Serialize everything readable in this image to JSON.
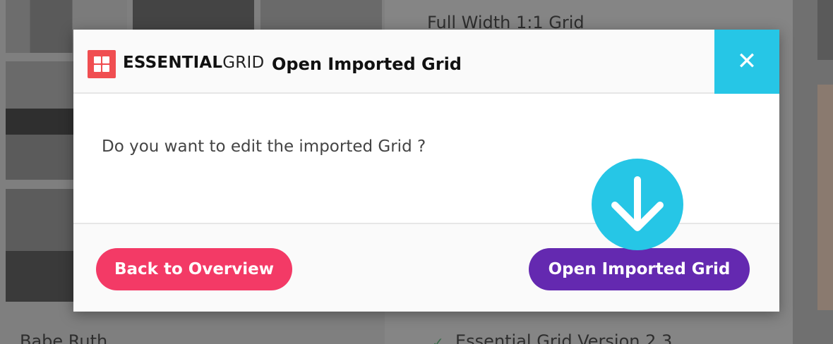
{
  "background": {
    "section_title": "Full Width 1:1 Grid",
    "item_name": "Babe Ruth",
    "version_label": "Essential Grid Version 2.3",
    "check_glyph": "✓"
  },
  "modal": {
    "brand": {
      "bold": "ESSENTIAL",
      "light": "GRID"
    },
    "title": "Open Imported Grid",
    "close_glyph": "✕",
    "question": "Do you want to edit the imported Grid ?",
    "buttons": {
      "back_label": "Back to Overview",
      "open_label": "Open Imported Grid"
    }
  },
  "colors": {
    "brand_red": "#f04e51",
    "close_cyan": "#26c6e6",
    "back_pink": "#f33a66",
    "open_purple": "#6429b0"
  },
  "icons": {
    "logo": "grid-logo-icon",
    "close": "close-icon",
    "hint": "arrow-down-icon"
  }
}
